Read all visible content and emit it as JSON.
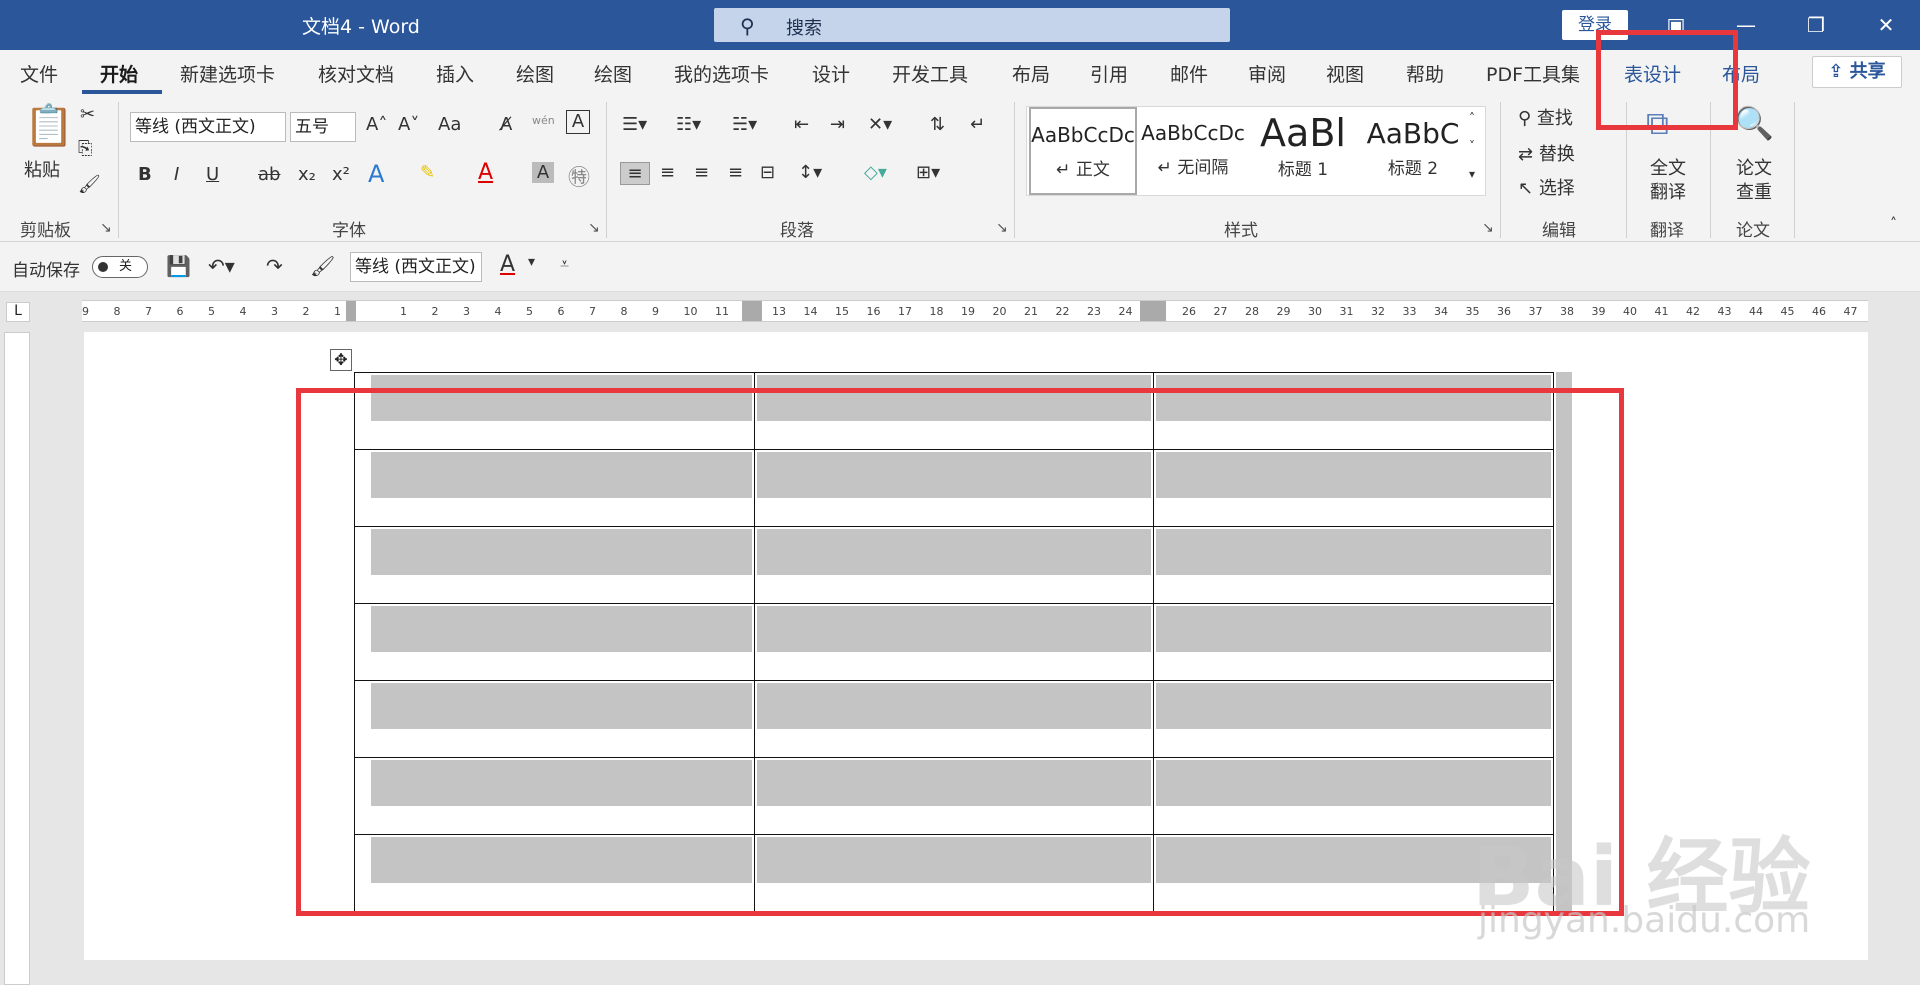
{
  "window": {
    "title": "文档4  -  Word",
    "search_icon": "search-icon",
    "search_label": "搜索",
    "login_label": "登录",
    "minimize": "—",
    "restore": "❐",
    "close": "✕"
  },
  "tabs": {
    "items": [
      "文件",
      "开始",
      "新建选项卡",
      "核对文档",
      "插入",
      "绘图",
      "绘图",
      "我的选项卡",
      "设计",
      "开发工具",
      "布局",
      "引用",
      "邮件",
      "审阅",
      "视图",
      "帮助",
      "PDF工具集",
      "表设计",
      "布局"
    ],
    "active": "开始",
    "share_label": "共享"
  },
  "ribbon": {
    "clipboard": {
      "paste": "粘贴",
      "group": "剪贴板"
    },
    "font": {
      "font_name": "等线 (西文正文)",
      "font_size": "五号",
      "group": "字体",
      "bold": "B",
      "italic": "I",
      "underline": "U",
      "strike": "ab",
      "subscript": "x₂",
      "superscript": "x²",
      "case": "Aa",
      "font_color_letter": "A",
      "pinyin": "wén"
    },
    "paragraph": {
      "group": "段落"
    },
    "styles": {
      "group": "样式",
      "items": [
        {
          "sample": "AaBbCcDc",
          "name": "↵ 正文"
        },
        {
          "sample": "AaBbCcDc",
          "name": "↵ 无间隔"
        },
        {
          "sample": "AaBl",
          "name": "标题 1"
        },
        {
          "sample": "AaBbC",
          "name": "标题 2"
        }
      ]
    },
    "editing": {
      "find": "查找",
      "replace": "替换",
      "select": "选择",
      "group": "编辑"
    },
    "translate": {
      "full": "全文",
      "translate": "翻译",
      "group": "翻译"
    },
    "thesis": {
      "line1": "论文",
      "line2": "查重",
      "group": "论文"
    }
  },
  "qat": {
    "autosave": "自动保存",
    "toggle": "关",
    "font_name": "等线 (西文正文)",
    "font_color_letter": "A"
  },
  "ruler": {
    "left_ticks": [
      "9",
      "8",
      "7",
      "6",
      "5",
      "4",
      "3",
      "2",
      "1"
    ],
    "ticks_a": [
      "1",
      "2",
      "3",
      "4",
      "5",
      "6",
      "7",
      "8",
      "9",
      "10",
      "11"
    ],
    "ticks_b": [
      "13",
      "14",
      "15",
      "16",
      "17",
      "18",
      "19",
      "20",
      "21",
      "22",
      "23",
      "24"
    ],
    "ticks_c": [
      "26",
      "27",
      "28",
      "29",
      "30",
      "31",
      "32",
      "33",
      "34",
      "35",
      "36",
      "37",
      "38",
      "39",
      "40",
      "41",
      "42",
      "43",
      "44",
      "45",
      "46",
      "47"
    ],
    "corner": "L"
  },
  "table": {
    "rows": 7,
    "cols": 3
  },
  "watermark": {
    "main": "Bai 经验",
    "sub": "jingyan.baidu.com"
  },
  "colors": {
    "accent": "#2b579a",
    "highlight": "#e8383d",
    "shade": "#c4c4c4"
  }
}
